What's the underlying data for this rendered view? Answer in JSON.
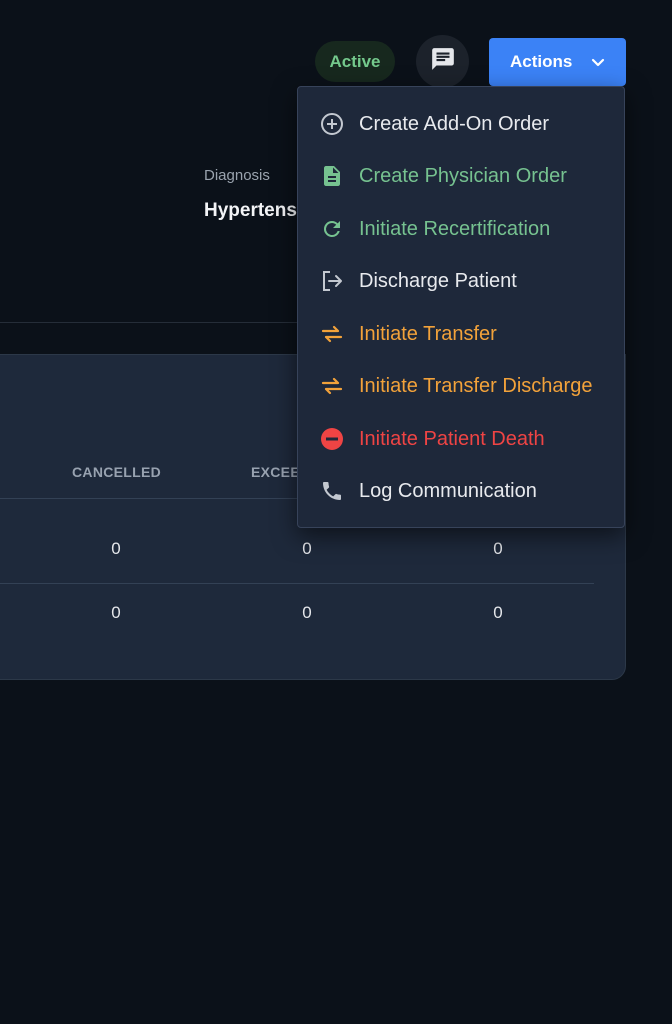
{
  "header": {
    "status_badge": "Active",
    "actions_label": "Actions"
  },
  "diagnosis": {
    "label": "Diagnosis",
    "value": "Hypertension"
  },
  "table": {
    "columns": [
      "CANCELLED",
      "EXCEEDED",
      ""
    ],
    "rows": [
      [
        "0",
        "0",
        "0"
      ],
      [
        "0",
        "0",
        "0"
      ]
    ]
  },
  "actions_menu": {
    "items": [
      {
        "label": "Create Add-On Order",
        "icon": "add-circle-icon",
        "color": "#e8eaee"
      },
      {
        "label": "Create Physician Order",
        "icon": "document-icon",
        "color": "#76c290"
      },
      {
        "label": "Initiate Recertification",
        "icon": "refresh-icon",
        "color": "#76c290"
      },
      {
        "label": "Discharge Patient",
        "icon": "exit-icon",
        "color": "#e8eaee"
      },
      {
        "label": "Initiate Transfer",
        "icon": "swap-arrows-icon",
        "color": "#f2a23a"
      },
      {
        "label": "Initiate Transfer Discharge",
        "icon": "swap-arrows-icon",
        "color": "#f2a23a"
      },
      {
        "label": "Initiate Patient Death",
        "icon": "minus-circle-icon",
        "color": "#ef4444"
      },
      {
        "label": "Log Communication",
        "icon": "phone-icon",
        "color": "#e8eaee"
      }
    ]
  },
  "colors": {
    "background": "#0b1119",
    "card": "#1e293b",
    "accent": "#3b82f6",
    "active_badge_bg": "#17281e",
    "active_badge_text": "#74c98c"
  }
}
